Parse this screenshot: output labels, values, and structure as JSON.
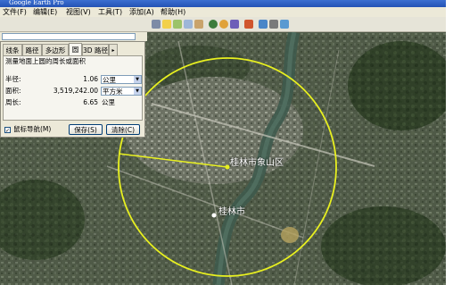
{
  "window": {
    "title": "Google Earth Pro"
  },
  "menu": [
    "文件(F)",
    "编辑(E)",
    "视图(V)",
    "工具(T)",
    "添加(A)",
    "帮助(H)"
  ],
  "panel": {
    "tabs": [
      "线条",
      "路径",
      "多边形",
      "圆",
      "3D 路径"
    ],
    "active_tab": 3,
    "description": "测量地面上圆的周长或面积",
    "radius": {
      "label": "半径:",
      "value": "1.06",
      "unit": "公里"
    },
    "area": {
      "label": "面积:",
      "value": "3,519,242.00",
      "unit": "平方米"
    },
    "perimeter": {
      "label": "周长:",
      "value": "6.65",
      "unit": "公里"
    },
    "mouse_nav_label": "鼠标导航(M)",
    "mouse_nav_checked": true,
    "save_label": "保存(S)",
    "clear_label": "清除(C)",
    "tab_scroll_icon": "chevron-right-icon"
  },
  "map": {
    "labels": [
      {
        "text": "桂林市象山区",
        "kind": "place-label"
      },
      {
        "text": "桂林市",
        "kind": "city-label"
      }
    ],
    "circle_color": "#e8f020"
  }
}
